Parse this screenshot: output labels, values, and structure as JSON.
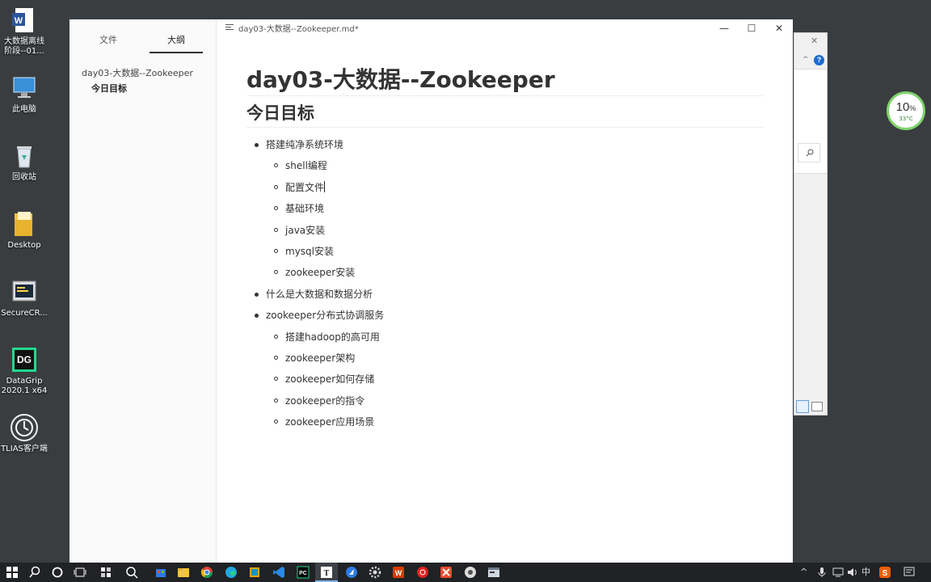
{
  "desktop": {
    "icons": [
      {
        "label": "大数据离线\n阶段--01..."
      },
      {
        "label": "此电脑"
      },
      {
        "label": "回收站"
      },
      {
        "label": "Desktop"
      },
      {
        "label": "SecureCR..."
      },
      {
        "label": "DataGrip\n2020.1 x64"
      },
      {
        "label": "TLIAS客户端"
      }
    ]
  },
  "gauge": {
    "percent": "10",
    "unit": "%",
    "temp": "33°C"
  },
  "window": {
    "title": "day03-大数据--Zookeeper.md*",
    "controls": {
      "minimize": "—",
      "maximize": "☐",
      "close": "✕"
    }
  },
  "sidebar": {
    "tabs": [
      {
        "label": "文件"
      },
      {
        "label": "大纲"
      }
    ],
    "active_tab": "大纲",
    "outline": [
      {
        "label": "day03-大数据--Zookeeper",
        "level": 1
      },
      {
        "label": "今日目标",
        "level": 2
      }
    ]
  },
  "document": {
    "h1": "day03-大数据--Zookeeper",
    "h2": "今日目标",
    "list": [
      {
        "text": "搭建纯净系统环境",
        "children": [
          "shell编程",
          "配置文件",
          "基础环境",
          "java安装",
          "mysql安装",
          "zookeeper安装"
        ]
      },
      {
        "text": "什么是大数据和数据分析",
        "children": []
      },
      {
        "text": "zookeeper分布式协调服务",
        "children": [
          "搭建hadoop的高可用",
          "zookeeper架构",
          "zookeeper如何存储",
          "zookeeper的指令",
          "zookeeper应用场景"
        ]
      }
    ]
  },
  "taskbar": {
    "tray": {
      "ime": "中"
    }
  },
  "colors": {
    "accent": "#333333",
    "gauge_ring": "#7fd36d",
    "taskbar": "#202225"
  }
}
